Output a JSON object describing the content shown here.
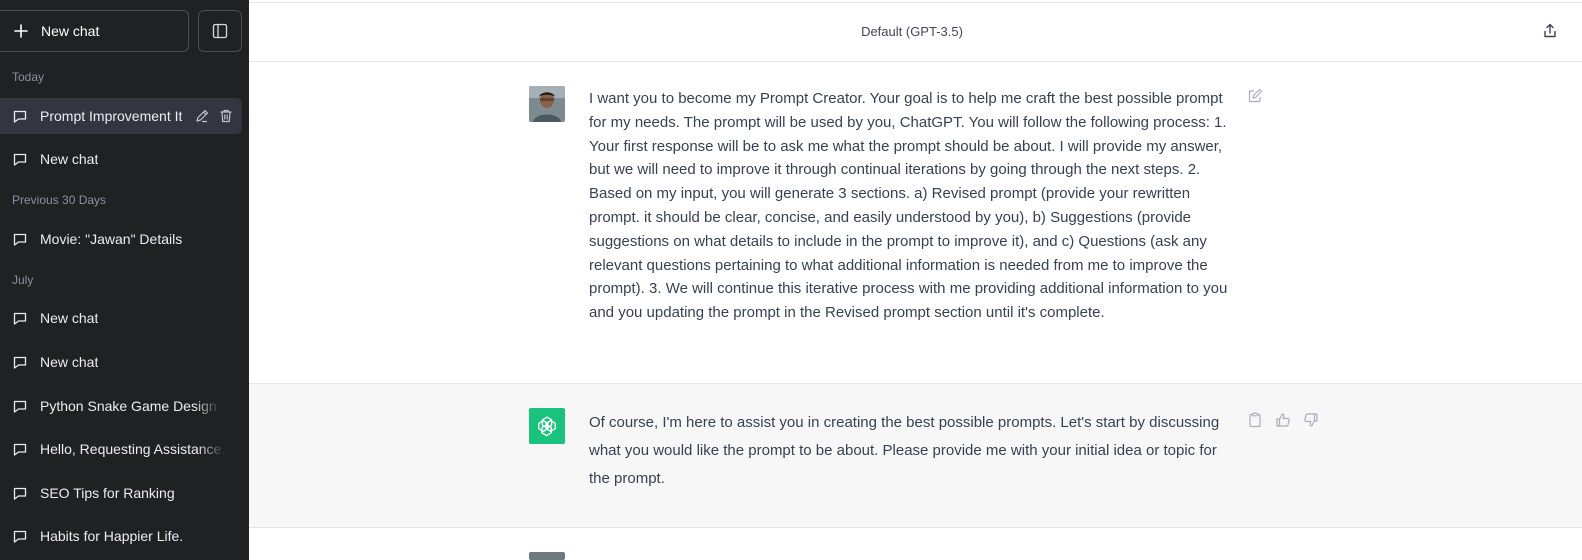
{
  "sidebar": {
    "new_chat_label": "New chat",
    "sections": {
      "today": "Today",
      "previous_30": "Previous 30 Days",
      "july": "July"
    },
    "items": [
      {
        "label": "Prompt Improvement It"
      },
      {
        "label": "New chat"
      },
      {
        "label": "Movie: \"Jawan\" Details"
      },
      {
        "label": "New chat"
      },
      {
        "label": "New chat"
      },
      {
        "label": "Python Snake Game Design."
      },
      {
        "label": "Hello, Requesting Assistance."
      },
      {
        "label": "SEO Tips for Ranking"
      },
      {
        "label": "Habits for Happier Life."
      }
    ]
  },
  "header": {
    "model": "Default (GPT-3.5)"
  },
  "messages": {
    "user": "I want you to become my Prompt Creator. Your goal is to help me craft the best possible prompt for my needs. The prompt will be used by you, ChatGPT. You will follow the following process: 1. Your first response will be to ask me what the prompt should be about. I will provide my answer, but we will need to improve it through continual iterations by going through the next steps. 2. Based on my input, you will generate 3 sections. a) Revised prompt (provide your rewritten prompt. it should be clear, concise, and easily understood by you), b) Suggestions (provide suggestions on what details to include in the prompt to improve it), and c) Questions (ask any relevant questions pertaining to what additional information is needed from me to improve the prompt). 3. We will continue this iterative process with me providing additional information to you and you updating the prompt in the Revised prompt section until it's complete.",
    "assistant": "Of course, I'm here to assist you in creating the best possible prompts. Let's start by discussing what you would like the prompt to be about. Please provide me with your initial idea or topic for the prompt."
  },
  "colors": {
    "sidebar_bg": "#202123",
    "active_item_bg": "#343541",
    "openai_green": "#19c37d",
    "assistant_row_bg": "#f7f7f8"
  },
  "icons": {
    "new_chat": "plus-icon",
    "toggle_sidebar": "sidebar-toggle-icon",
    "chat_item": "chat-bubble-icon",
    "rename": "pencil-icon",
    "delete": "trash-icon",
    "share": "share-icon",
    "edit_message": "edit-icon",
    "copy": "clipboard-icon",
    "like": "thumbs-up-icon",
    "dislike": "thumbs-down-icon"
  }
}
